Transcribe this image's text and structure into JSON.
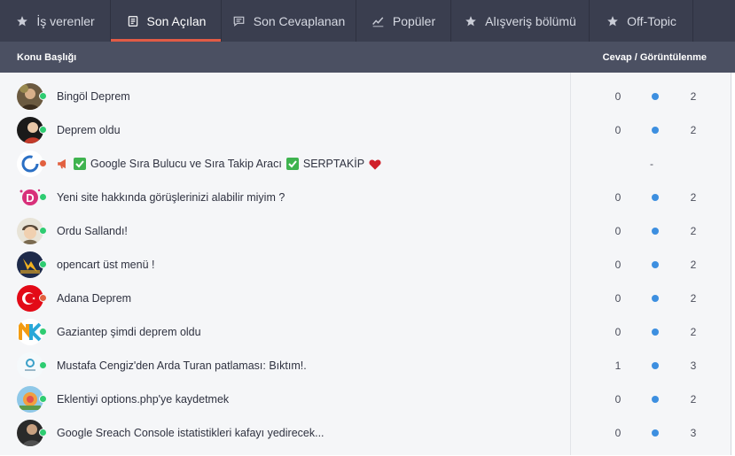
{
  "tabs": [
    {
      "label": "İş verenler",
      "icon": "star-icon",
      "active": false
    },
    {
      "label": "Son Açılan",
      "icon": "document-icon",
      "active": true
    },
    {
      "label": "Son Cevaplanan",
      "icon": "chat-icon",
      "active": false
    },
    {
      "label": "Popüler",
      "icon": "trend-icon",
      "active": false
    },
    {
      "label": "Alışveriş bölümü",
      "icon": "star-icon",
      "active": false
    },
    {
      "label": "Off-Topic",
      "icon": "star-icon",
      "active": false
    }
  ],
  "header": {
    "topic_title": "Konu Başlığı",
    "stats_title": "Cevap / Görüntülenme"
  },
  "colors": {
    "accent": "#e25b45",
    "online": "#2ecc71",
    "offline": "#e2603f",
    "stat_dot": "#3d8fe0"
  },
  "topics": [
    {
      "title": "Bingöl Deprem",
      "replies": "0",
      "views": "2",
      "status": "online",
      "avatar": "person-avatar"
    },
    {
      "title": "Deprem oldu",
      "replies": "0",
      "views": "2",
      "status": "online",
      "avatar": "person-avatar"
    },
    {
      "title": "Google Sıra Bulucu ve Sıra Takip Aracı",
      "title_suffix": "SERPTAKİP",
      "stats_text": "-",
      "status": "offline",
      "avatar": "ring-logo-avatar",
      "icons": [
        "megaphone-icon",
        "check-icon",
        "check-icon",
        "heart-icon"
      ]
    },
    {
      "title": "Yeni site hakkında görüşlerinizi alabilir miyim ?",
      "replies": "0",
      "views": "2",
      "status": "online",
      "avatar": "d-logo-avatar"
    },
    {
      "title": "Ordu Sallandı!",
      "replies": "0",
      "views": "2",
      "status": "online",
      "avatar": "cartoon-avatar"
    },
    {
      "title": "opencart üst menü !",
      "replies": "0",
      "views": "2",
      "status": "online",
      "avatar": "lightning-logo-avatar"
    },
    {
      "title": "Adana Deprem",
      "replies": "0",
      "views": "2",
      "status": "offline",
      "avatar": "turkish-flag-avatar"
    },
    {
      "title": "Gaziantep şimdi deprem oldu",
      "replies": "0",
      "views": "2",
      "status": "online",
      "avatar": "nk-logo-avatar"
    },
    {
      "title": "Mustafa Cengiz'den Arda Turan patlaması: Bıktım!.",
      "replies": "1",
      "views": "3",
      "status": "online",
      "avatar": "small-logo-avatar"
    },
    {
      "title": "Eklentiyi options.php'ye kaydetmek",
      "replies": "0",
      "views": "2",
      "status": "online",
      "avatar": "colorful-avatar"
    },
    {
      "title": "Google Sreach Console istatistikleri kafayı yedirecek...",
      "replies": "0",
      "views": "3",
      "status": "online",
      "avatar": "person-avatar"
    }
  ]
}
